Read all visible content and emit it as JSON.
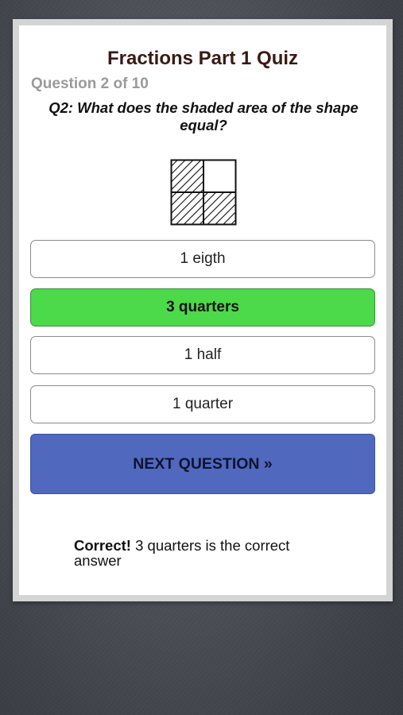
{
  "quiz": {
    "title": "Fractions Part 1 Quiz",
    "progress": "Question 2 of 10",
    "question": "Q2: What does the shaded area of the shape equal?"
  },
  "shape": {
    "icon": "quarter-grid-shape-icon",
    "grid": "2x2",
    "shaded_cells": [
      "top-left",
      "bottom-left",
      "bottom-right"
    ],
    "unshaded_cells": [
      "top-right"
    ]
  },
  "answers": [
    {
      "label": "1 eigth",
      "selected": false
    },
    {
      "label": "3 quarters",
      "selected": true
    },
    {
      "label": "1 half",
      "selected": false
    },
    {
      "label": "1 quarter",
      "selected": false
    }
  ],
  "next_button": {
    "label": "NEXT QUESTION »"
  },
  "feedback": {
    "status": "Correct!",
    "message": " 3 quarters is the correct answer"
  },
  "colors": {
    "selected_answer": "#4cd94a",
    "next_button": "#5068bd",
    "title": "#3a1a14",
    "progress_text": "#9a9a9a"
  }
}
